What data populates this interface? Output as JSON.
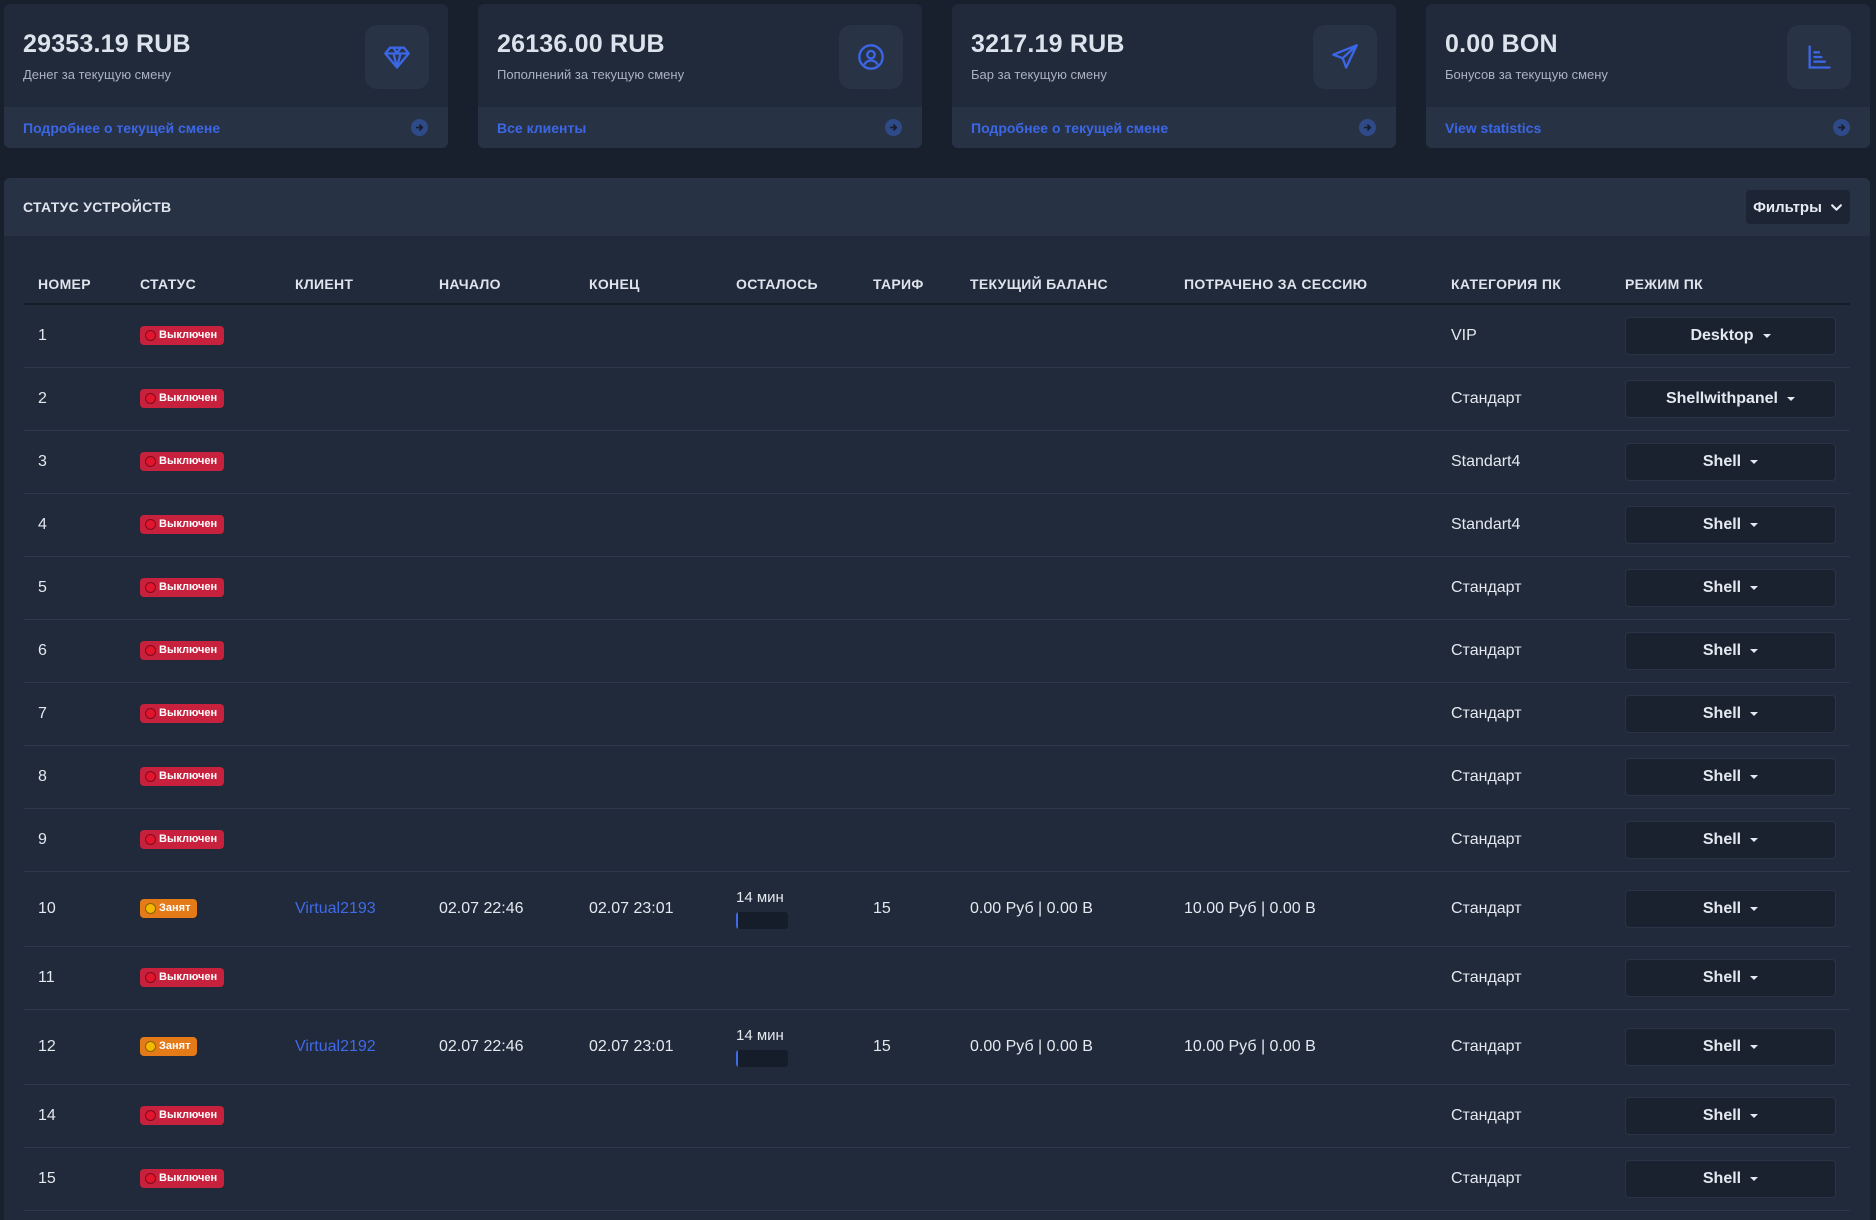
{
  "colors": {
    "page_bg": "#18202d",
    "card_bg": "#212a3a",
    "card_footer_bg": "#283245",
    "link_blue": "#3b67e6",
    "status_off": "#c8213d",
    "status_busy": "#e57a18"
  },
  "cards": [
    {
      "value": "29353.19 RUB",
      "caption": "Денег за текущую смену",
      "link": "Подробнее о текущей смене",
      "icon": "diamond-icon"
    },
    {
      "value": "26136.00 RUB",
      "caption": "Пополнений за текущую смену",
      "link": "Все клиенты",
      "icon": "user-circle-icon"
    },
    {
      "value": "3217.19 RUB",
      "caption": "Бар за текущую смену",
      "link": "Подробнее о текущей смене",
      "icon": "send-icon"
    },
    {
      "value": "0.00 BON",
      "caption": "Бонусов за текущую смену",
      "link": "View statistics",
      "icon": "bar-chart-icon"
    }
  ],
  "panel": {
    "title": "СТАТУС УСТРОЙСТВ",
    "filters_label": "Фильтры"
  },
  "table": {
    "headers": {
      "number": "НОМЕР",
      "status": "СТАТУС",
      "client": "КЛИЕНТ",
      "start": "НАЧАЛО",
      "end": "КОНЕЦ",
      "remaining": "ОСТАЛОСЬ",
      "tariff": "ТАРИФ",
      "balance": "ТЕКУЩИЙ БАЛАНС",
      "spent": "ПОТРАЧЕНО ЗА СЕССИЮ",
      "category": "КАТЕГОРИЯ ПК",
      "mode": "РЕЖИМ ПК"
    },
    "rows": [
      {
        "number": "1",
        "status": "Выключен",
        "state": "off",
        "client": "",
        "start": "",
        "end": "",
        "remaining": "",
        "progress": 0,
        "tariff": "",
        "balance": "",
        "spent": "",
        "category": "VIP",
        "mode": "Desktop"
      },
      {
        "number": "2",
        "status": "Выключен",
        "state": "off",
        "client": "",
        "start": "",
        "end": "",
        "remaining": "",
        "progress": 0,
        "tariff": "",
        "balance": "",
        "spent": "",
        "category": "Стандарт",
        "mode": "Shellwithpanel"
      },
      {
        "number": "3",
        "status": "Выключен",
        "state": "off",
        "client": "",
        "start": "",
        "end": "",
        "remaining": "",
        "progress": 0,
        "tariff": "",
        "balance": "",
        "spent": "",
        "category": "Standart4",
        "mode": "Shell"
      },
      {
        "number": "4",
        "status": "Выключен",
        "state": "off",
        "client": "",
        "start": "",
        "end": "",
        "remaining": "",
        "progress": 0,
        "tariff": "",
        "balance": "",
        "spent": "",
        "category": "Standart4",
        "mode": "Shell"
      },
      {
        "number": "5",
        "status": "Выключен",
        "state": "off",
        "client": "",
        "start": "",
        "end": "",
        "remaining": "",
        "progress": 0,
        "tariff": "",
        "balance": "",
        "spent": "",
        "category": "Стандарт",
        "mode": "Shell"
      },
      {
        "number": "6",
        "status": "Выключен",
        "state": "off",
        "client": "",
        "start": "",
        "end": "",
        "remaining": "",
        "progress": 0,
        "tariff": "",
        "balance": "",
        "spent": "",
        "category": "Стандарт",
        "mode": "Shell"
      },
      {
        "number": "7",
        "status": "Выключен",
        "state": "off",
        "client": "",
        "start": "",
        "end": "",
        "remaining": "",
        "progress": 0,
        "tariff": "",
        "balance": "",
        "spent": "",
        "category": "Стандарт",
        "mode": "Shell"
      },
      {
        "number": "8",
        "status": "Выключен",
        "state": "off",
        "client": "",
        "start": "",
        "end": "",
        "remaining": "",
        "progress": 0,
        "tariff": "",
        "balance": "",
        "spent": "",
        "category": "Стандарт",
        "mode": "Shell"
      },
      {
        "number": "9",
        "status": "Выключен",
        "state": "off",
        "client": "",
        "start": "",
        "end": "",
        "remaining": "",
        "progress": 0,
        "tariff": "",
        "balance": "",
        "spent": "",
        "category": "Стандарт",
        "mode": "Shell"
      },
      {
        "number": "10",
        "status": "Занят",
        "state": "busy",
        "client": "Virtual2193",
        "start": "02.07 22:46",
        "end": "02.07 23:01",
        "remaining": "14 мин",
        "progress": 0.04,
        "tariff": "15",
        "balance": "0.00 Руб | 0.00 B",
        "spent": "10.00 Руб | 0.00 B",
        "category": "Стандарт",
        "mode": "Shell"
      },
      {
        "number": "11",
        "status": "Выключен",
        "state": "off",
        "client": "",
        "start": "",
        "end": "",
        "remaining": "",
        "progress": 0,
        "tariff": "",
        "balance": "",
        "spent": "",
        "category": "Стандарт",
        "mode": "Shell"
      },
      {
        "number": "12",
        "status": "Занят",
        "state": "busy",
        "client": "Virtual2192",
        "start": "02.07 22:46",
        "end": "02.07 23:01",
        "remaining": "14 мин",
        "progress": 0.04,
        "tariff": "15",
        "balance": "0.00 Руб | 0.00 B",
        "spent": "10.00 Руб | 0.00 B",
        "category": "Стандарт",
        "mode": "Shell"
      },
      {
        "number": "14",
        "status": "Выключен",
        "state": "off",
        "client": "",
        "start": "",
        "end": "",
        "remaining": "",
        "progress": 0,
        "tariff": "",
        "balance": "",
        "spent": "",
        "category": "Стандарт",
        "mode": "Shell"
      },
      {
        "number": "15",
        "status": "Выключен",
        "state": "off",
        "client": "",
        "start": "",
        "end": "",
        "remaining": "",
        "progress": 0,
        "tariff": "",
        "balance": "",
        "spent": "",
        "category": "Стандарт",
        "mode": "Shell"
      }
    ]
  }
}
